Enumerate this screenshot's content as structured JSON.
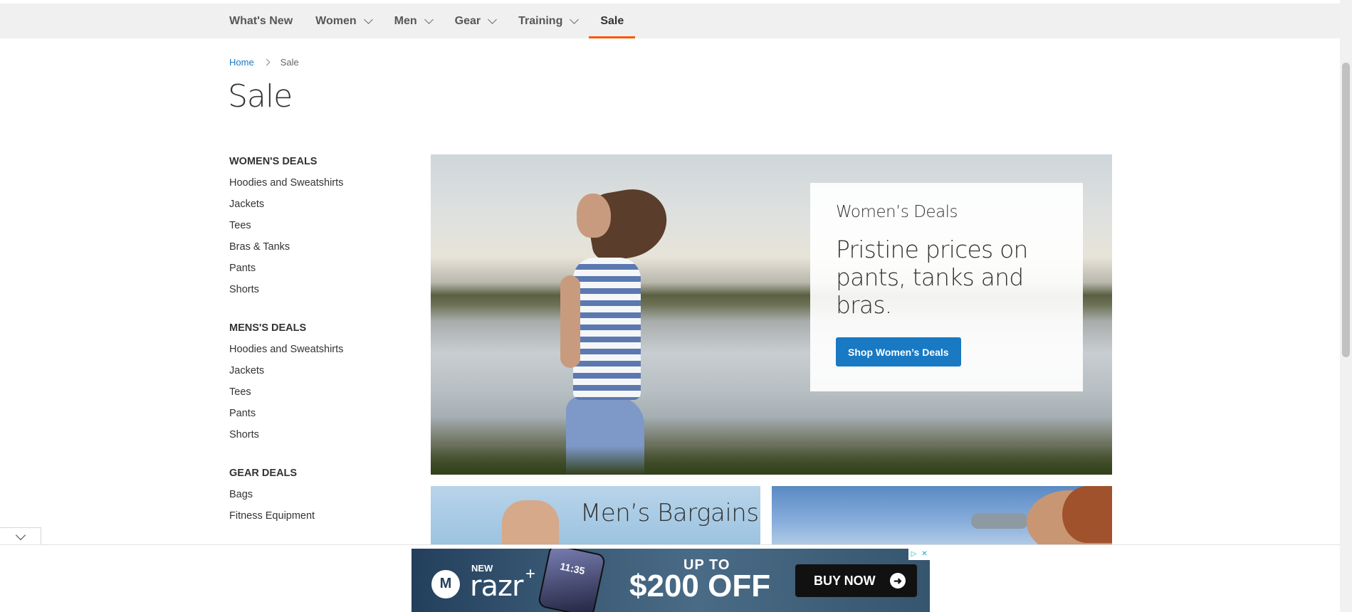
{
  "nav": {
    "items": [
      {
        "label": "What's New",
        "dropdown": false
      },
      {
        "label": "Women",
        "dropdown": true
      },
      {
        "label": "Men",
        "dropdown": true
      },
      {
        "label": "Gear",
        "dropdown": true
      },
      {
        "label": "Training",
        "dropdown": true
      },
      {
        "label": "Sale",
        "dropdown": false,
        "active": true
      }
    ],
    "accent_color": "#ff5501"
  },
  "breadcrumb": {
    "home": "Home",
    "current": "Sale"
  },
  "page_title": "Sale",
  "sidebar": {
    "groups": [
      {
        "title": "WOMEN'S DEALS",
        "links": [
          "Hoodies and Sweatshirts",
          "Jackets",
          "Tees",
          "Bras & Tanks",
          "Pants",
          "Shorts"
        ]
      },
      {
        "title": "MENS'S DEALS",
        "links": [
          "Hoodies and Sweatshirts",
          "Jackets",
          "Tees",
          "Pants",
          "Shorts"
        ]
      },
      {
        "title": "GEAR DEALS",
        "links": [
          "Bags",
          "Fitness Equipment"
        ]
      }
    ]
  },
  "hero": {
    "kicker": "Women’s Deals",
    "headline": "Pristine prices on pants, tanks and bras.",
    "button": "Shop Women’s Deals",
    "button_color": "#1979c3"
  },
  "tiles": {
    "men_title": "Men’s Bargains"
  },
  "ad": {
    "new": "NEW",
    "brand": "razr",
    "brand_plus": "+",
    "phone_clock": "11:35",
    "up_to": "UP TO",
    "amount": "$200 OFF",
    "cta": "BUY NOW",
    "icons": [
      "motorola-logo-icon",
      "ad-choices-icon",
      "close-icon",
      "arrow-right-icon"
    ]
  }
}
